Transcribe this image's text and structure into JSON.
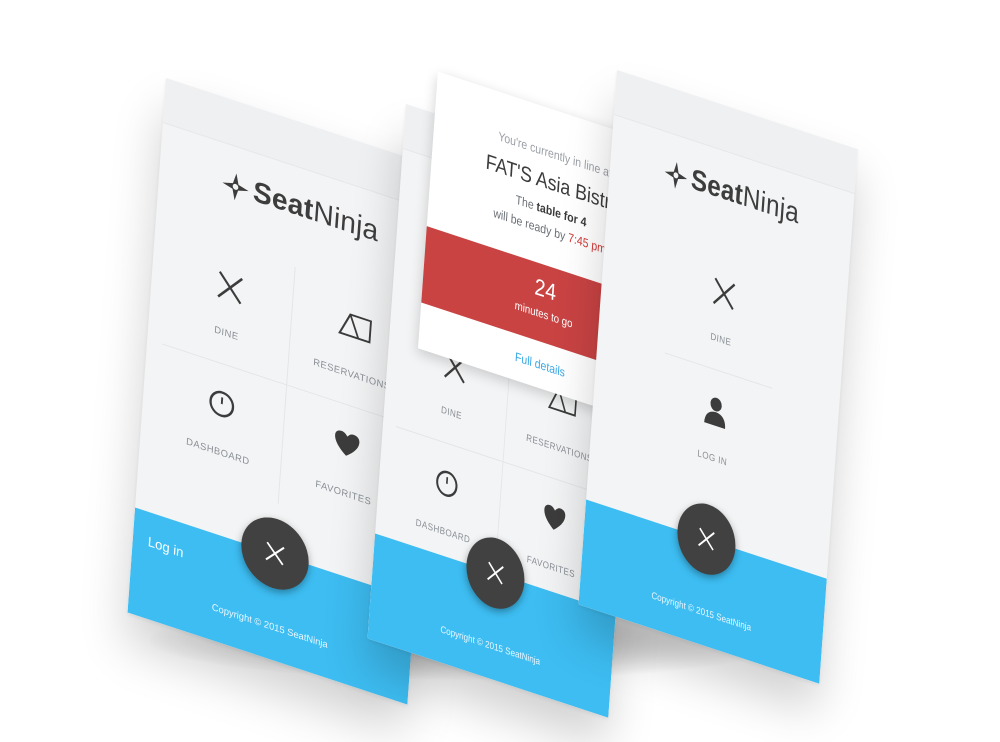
{
  "brand": {
    "seat": "Seat",
    "ninja": "Ninja"
  },
  "menu": {
    "dine": "DINE",
    "reservations": "RESERVATIONS",
    "dashboard": "DASHBOARD",
    "favorites": "FAVORITES",
    "login_item": "LOG IN"
  },
  "footer": {
    "login_label": "Log in",
    "copyright": "Copyright © 2015 SeatNinja"
  },
  "queue": {
    "line1": "You're currently in line at",
    "restaurant": "FAT'S Asia Bistro",
    "the": "The",
    "table": "table for 4",
    "ready_prefix": "will be ready by",
    "ready_time": "7:45 pm",
    "minutes": "24",
    "minutes_label": "minutes to go",
    "details": "Full details"
  },
  "icons": {
    "dine": "fork-knife-icon",
    "reservations": "tent-card-icon",
    "dashboard": "clock-icon",
    "favorites": "heart-icon",
    "login": "user-icon",
    "fab": "close-icon",
    "logo": "ninja-star-icon"
  },
  "colors": {
    "accent": "#3dbdf2",
    "alert": "#c94343",
    "fab": "#414141",
    "link": "#3aa9e6"
  }
}
